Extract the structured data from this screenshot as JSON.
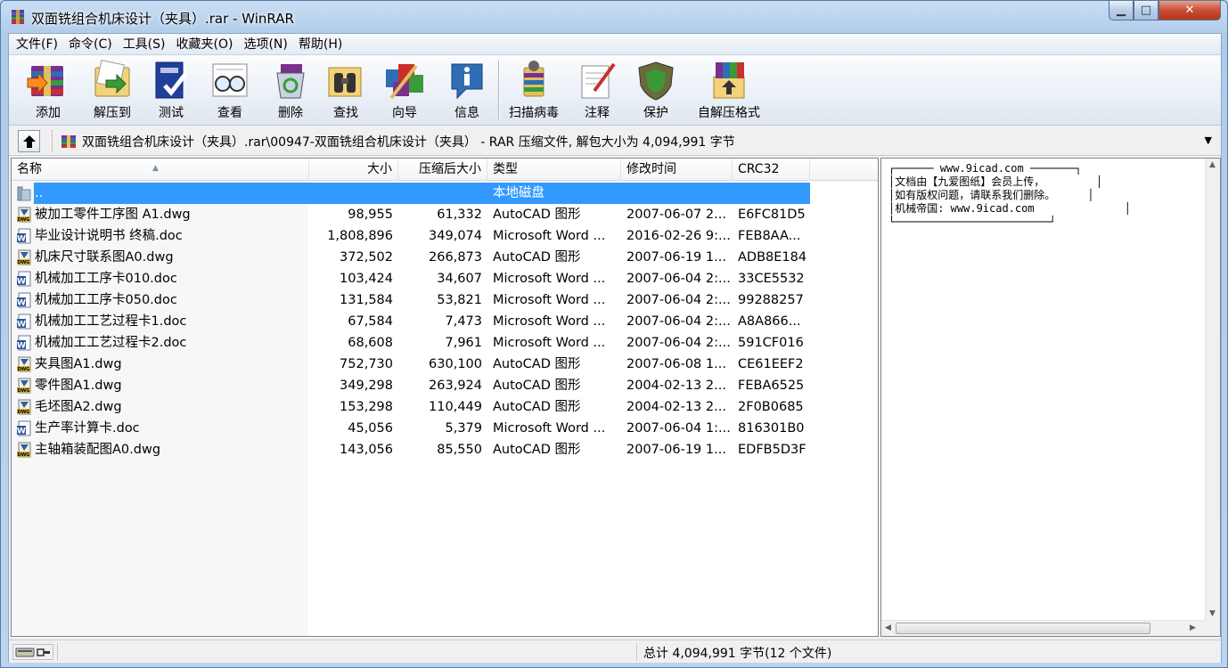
{
  "window": {
    "title": "双面铣组合机床设计（夹具）.rar - WinRAR",
    "controls": {
      "minimize": "▁",
      "maximize": "□",
      "close": "✕"
    }
  },
  "menu": [
    "文件(F)",
    "命令(C)",
    "工具(S)",
    "收藏夹(O)",
    "选项(N)",
    "帮助(H)"
  ],
  "toolbar": {
    "add": "添加",
    "extract": "解压到",
    "test": "测试",
    "view": "查看",
    "delete": "删除",
    "find": "查找",
    "wizard": "向导",
    "info": "信息",
    "scan": "扫描病毒",
    "comment": "注释",
    "protect": "保护",
    "sfx": "自解压格式"
  },
  "address": {
    "path": "双面铣组合机床设计（夹具）.rar\\00947-双面铣组合机床设计（夹具） - RAR 压缩文件, 解包大小为 4,094,991 字节"
  },
  "columns": {
    "name": "名称",
    "size": "大小",
    "packed": "压缩后大小",
    "type": "类型",
    "modified": "修改时间",
    "crc": "CRC32"
  },
  "files": [
    {
      "name": "..",
      "size": "",
      "packed": "",
      "type": "本地磁盘",
      "modified": "",
      "crc": "",
      "icon": "folder-up"
    },
    {
      "name": "被加工零件工序图 A1.dwg",
      "size": "98,955",
      "packed": "61,332",
      "type": "AutoCAD 图形",
      "modified": "2007-06-07 2...",
      "crc": "E6FC81D5",
      "icon": "dwg"
    },
    {
      "name": "毕业设计说明书 终稿.doc",
      "size": "1,808,896",
      "packed": "349,074",
      "type": "Microsoft Word ...",
      "modified": "2016-02-26 9:...",
      "crc": "FEB8AA...",
      "icon": "doc"
    },
    {
      "name": "机床尺寸联系图A0.dwg",
      "size": "372,502",
      "packed": "266,873",
      "type": "AutoCAD 图形",
      "modified": "2007-06-19 1...",
      "crc": "ADB8E184",
      "icon": "dwg"
    },
    {
      "name": "机械加工工序卡010.doc",
      "size": "103,424",
      "packed": "34,607",
      "type": "Microsoft Word ...",
      "modified": "2007-06-04 2:...",
      "crc": "33CE5532",
      "icon": "doc"
    },
    {
      "name": "机械加工工序卡050.doc",
      "size": "131,584",
      "packed": "53,821",
      "type": "Microsoft Word ...",
      "modified": "2007-06-04 2:...",
      "crc": "99288257",
      "icon": "doc"
    },
    {
      "name": "机械加工工艺过程卡1.doc",
      "size": "67,584",
      "packed": "7,473",
      "type": "Microsoft Word ...",
      "modified": "2007-06-04 2:...",
      "crc": "A8A866...",
      "icon": "doc"
    },
    {
      "name": "机械加工工艺过程卡2.doc",
      "size": "68,608",
      "packed": "7,961",
      "type": "Microsoft Word ...",
      "modified": "2007-06-04 2:...",
      "crc": "591CF016",
      "icon": "doc"
    },
    {
      "name": "夹具图A1.dwg",
      "size": "752,730",
      "packed": "630,100",
      "type": "AutoCAD 图形",
      "modified": "2007-06-08 1...",
      "crc": "CE61EEF2",
      "icon": "dwg"
    },
    {
      "name": "零件图A1.dwg",
      "size": "349,298",
      "packed": "263,924",
      "type": "AutoCAD 图形",
      "modified": "2004-02-13 2...",
      "crc": "FEBA6525",
      "icon": "dwg"
    },
    {
      "name": "毛坯图A2.dwg",
      "size": "153,298",
      "packed": "110,449",
      "type": "AutoCAD 图形",
      "modified": "2004-02-13 2...",
      "crc": "2F0B0685",
      "icon": "dwg"
    },
    {
      "name": "生产率计算卡.doc",
      "size": "45,056",
      "packed": "5,379",
      "type": "Microsoft Word ...",
      "modified": "2007-06-04 1:...",
      "crc": "816301B0",
      "icon": "doc"
    },
    {
      "name": "主轴箱装配图A0.dwg",
      "size": "143,056",
      "packed": "85,550",
      "type": "AutoCAD 图形",
      "modified": "2007-06-19 1...",
      "crc": "EDFB5D3F",
      "icon": "dwg"
    }
  ],
  "comment": {
    "text": "┌────── www.9icad.com ───────┐\n│文档由【九爱图纸】会员上传，        │\n│如有版权问题，请联系我们删除。     │\n│机械帝国: www.9icad.com              │\n└────────────────────────┘"
  },
  "status": {
    "summary": "总计 4,094,991 字节(12 个文件)"
  },
  "colors": {
    "selection": "#3399ff",
    "title_gradient": "#aecbea"
  }
}
